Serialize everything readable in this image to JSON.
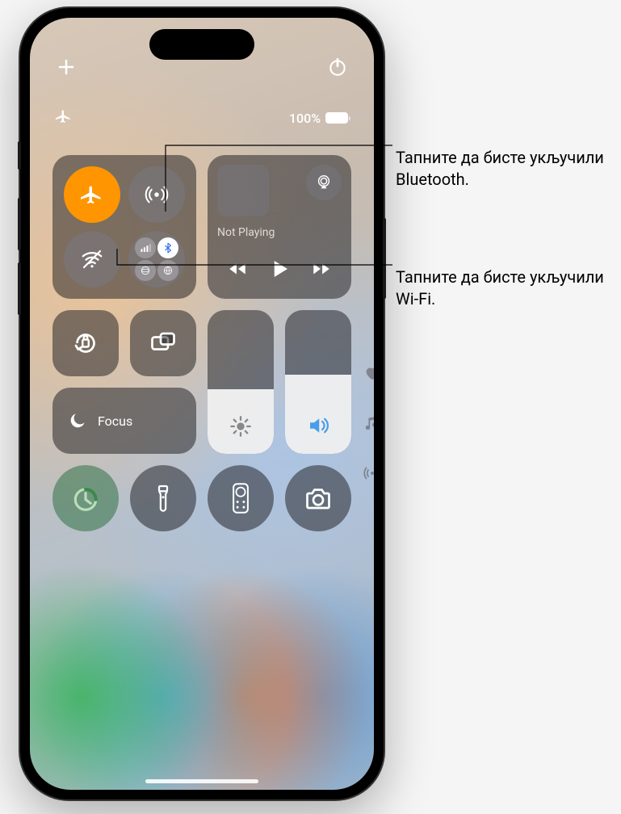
{
  "status": {
    "battery_text": "100%"
  },
  "media": {
    "title": "Not Playing"
  },
  "focus": {
    "label": "Focus"
  },
  "sliders": {
    "brightness_pct": 45,
    "volume_pct": 55
  },
  "callouts": {
    "bluetooth": "Тапните да бисте укључили Bluetooth.",
    "wifi": "Тапните да бисте укључили Wi-Fi."
  }
}
